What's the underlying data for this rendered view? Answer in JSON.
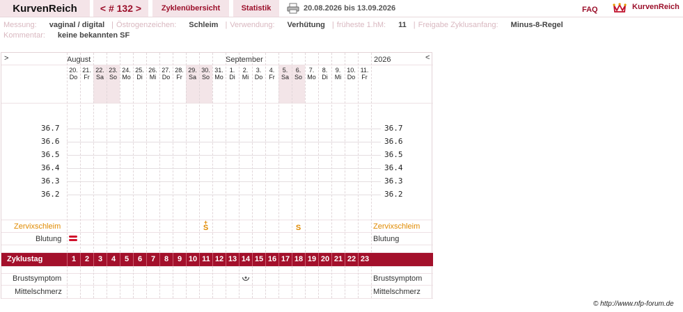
{
  "header": {
    "brand": "KurvenReich",
    "cycle_nav": "< # 132 >",
    "overview": "Zyklenübersicht",
    "stats": "Statistik",
    "date_range": "20.08.2026 bis 13.09.2026",
    "faq": "FAQ",
    "logo_text": "KurvenReich",
    "icons": [
      "printer-icon",
      "crown-logo-icon"
    ]
  },
  "info": {
    "messung_label": "Messung:",
    "messung_value": "vaginal / digital",
    "oestrogen_label": "Östrogenzeichen:",
    "oestrogen_value": "Schleim",
    "verwendung_label": "Verwendung:",
    "verwendung_value": "Verhütung",
    "frueheste_label": "früheste 1.hM:",
    "frueheste_value": "11",
    "freigabe_label": "Freigabe Zyklusanfang:",
    "freigabe_value": "Minus-8-Regel",
    "kommentar_label": "Kommentar:",
    "kommentar_value": "keine bekannten SF"
  },
  "chart": {
    "nav_left": ">",
    "nav_right": "<",
    "month_august": "August",
    "month_september": "September",
    "year": "2026",
    "days": [
      {
        "date": "20.",
        "dow": "Do",
        "weekend": false
      },
      {
        "date": "21.",
        "dow": "Fr",
        "weekend": false
      },
      {
        "date": "22.",
        "dow": "Sa",
        "weekend": true
      },
      {
        "date": "23.",
        "dow": "So",
        "weekend": true
      },
      {
        "date": "24.",
        "dow": "Mo",
        "weekend": false
      },
      {
        "date": "25.",
        "dow": "Di",
        "weekend": false
      },
      {
        "date": "26.",
        "dow": "Mi",
        "weekend": false
      },
      {
        "date": "27.",
        "dow": "Do",
        "weekend": false
      },
      {
        "date": "28.",
        "dow": "Fr",
        "weekend": false
      },
      {
        "date": "29.",
        "dow": "Sa",
        "weekend": true
      },
      {
        "date": "30.",
        "dow": "So",
        "weekend": true
      },
      {
        "date": "31.",
        "dow": "Mo",
        "weekend": false
      },
      {
        "date": "1.",
        "dow": "Di",
        "weekend": false
      },
      {
        "date": "2.",
        "dow": "Mi",
        "weekend": false
      },
      {
        "date": "3.",
        "dow": "Do",
        "weekend": false
      },
      {
        "date": "4.",
        "dow": "Fr",
        "weekend": false
      },
      {
        "date": "5.",
        "dow": "Sa",
        "weekend": true
      },
      {
        "date": "6.",
        "dow": "So",
        "weekend": true
      },
      {
        "date": "7.",
        "dow": "Mo",
        "weekend": false
      },
      {
        "date": "8.",
        "dow": "Di",
        "weekend": false
      },
      {
        "date": "9.",
        "dow": "Mi",
        "weekend": false
      },
      {
        "date": "10.",
        "dow": "Do",
        "weekend": false
      },
      {
        "date": "11.",
        "dow": "Fr",
        "weekend": false
      }
    ],
    "temps": [
      "36.7",
      "36.6",
      "36.5",
      "36.4",
      "36.3",
      "36.2"
    ],
    "zervix_label": "Zervixschleim",
    "blutung_label": "Blutung",
    "zyklustag_label": "Zyklustag",
    "zyklustage": [
      "1",
      "2",
      "3",
      "4",
      "5",
      "6",
      "7",
      "8",
      "9",
      "10",
      "11",
      "12",
      "13",
      "14",
      "15",
      "16",
      "17",
      "18",
      "19",
      "20",
      "21",
      "22",
      "23"
    ],
    "brust_label": "Brustsymptom",
    "mittel_label": "Mittelschmerz",
    "zervix_marks": [
      {
        "day": 11,
        "symbol": "S",
        "plus": "+"
      },
      {
        "day": 18,
        "symbol": "S",
        "plus": ""
      }
    ],
    "blutung_marks": [
      {
        "day": 1
      }
    ],
    "brust_marks": [
      {
        "day": 14
      }
    ],
    "colors": {
      "accent": "#a3102b",
      "zervix": "#e08a00",
      "blutung": "#d0102b",
      "weekend": "#f3e5e8"
    }
  },
  "footer": {
    "copyright": "© http://www.nfp-forum.de"
  }
}
